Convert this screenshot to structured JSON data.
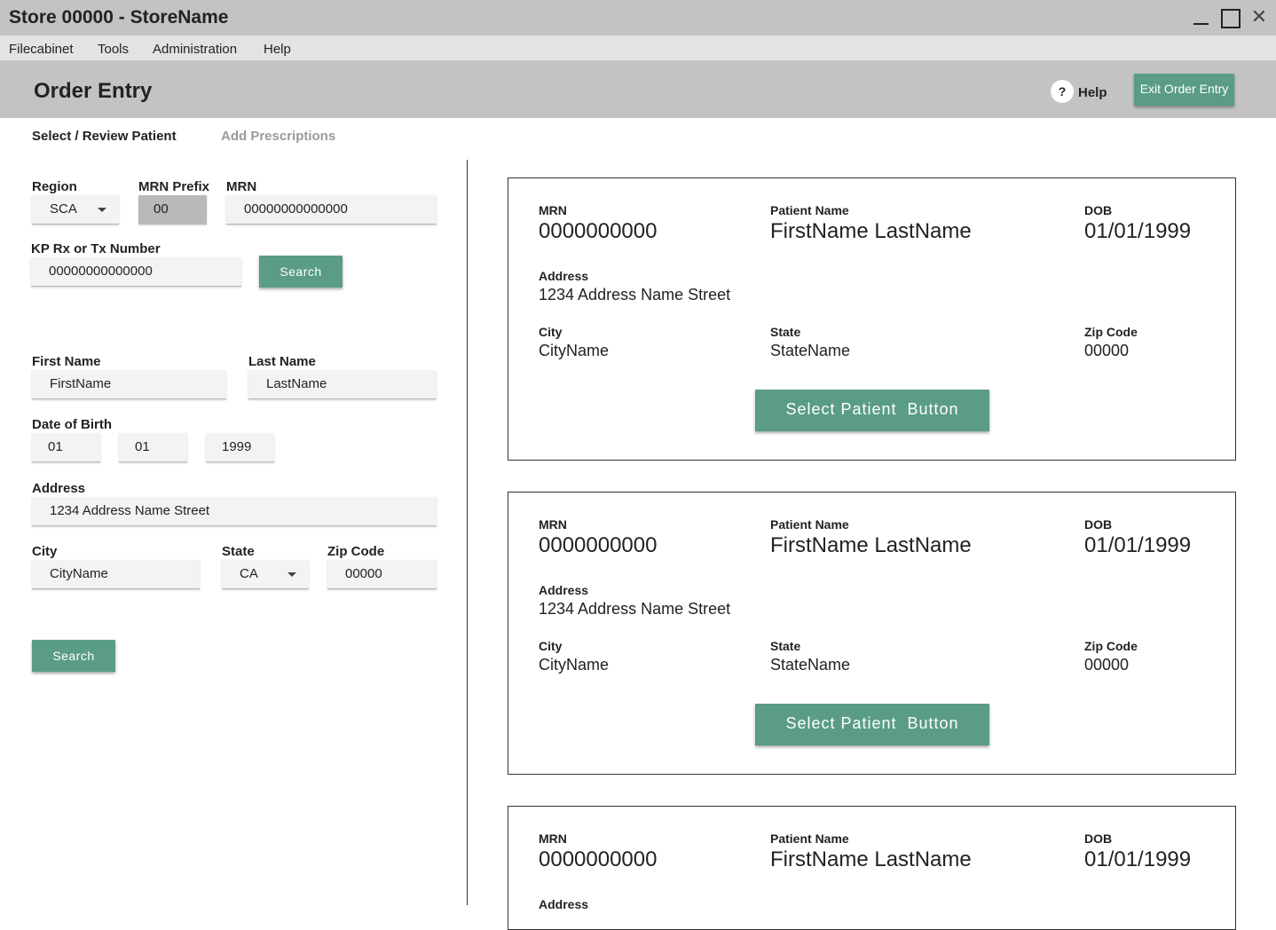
{
  "window": {
    "title": "Store 00000 - StoreName"
  },
  "menu": [
    "Filecabinet",
    "Tools",
    "Administration",
    "Help"
  ],
  "header": {
    "title": "Order Entry",
    "help_icon": "?",
    "help_label": "Help",
    "exit_label": "Exit Order Entry"
  },
  "steps": [
    "Select / Review Patient",
    "Add Prescriptions"
  ],
  "form": {
    "region_label": "Region",
    "region_value": "SCA",
    "mrn_prefix_label": "MRN Prefix",
    "mrn_prefix_value": "00",
    "mrn_label": "MRN",
    "mrn_value": "00000000000000",
    "rx_label": "KP Rx or Tx Number",
    "rx_value": "00000000000000",
    "search_label": "Search",
    "first_name_label": "First Name",
    "first_name_value": "FirstName",
    "last_name_label": "Last Name",
    "last_name_value": "LastName",
    "dob_label": "Date of Birth",
    "dob_month": "01",
    "dob_day": "01",
    "dob_year": "1999",
    "address_label": "Address",
    "address_value": "1234 Address Name Street",
    "city_label": "City",
    "city_value": "CityName",
    "state_label": "State",
    "state_value": "CA",
    "zip_label": "Zip Code",
    "zip_value": "00000",
    "search2_label": "Search"
  },
  "cards": [
    {
      "mrn_label": "MRN",
      "mrn": "0000000000",
      "name_label": "Patient Name",
      "name": "FirstName LastName",
      "dob_label": "DOB",
      "dob": "01/01/1999",
      "address_label": "Address",
      "address": "1234 Address Name Street",
      "city_label": "City",
      "city": "CityName",
      "state_label": "State",
      "state": "StateName",
      "zip_label": "Zip Code",
      "zip": "00000",
      "button": "Select Patient  Button"
    },
    {
      "mrn_label": "MRN",
      "mrn": "0000000000",
      "name_label": "Patient Name",
      "name": "FirstName LastName",
      "dob_label": "DOB",
      "dob": "01/01/1999",
      "address_label": "Address",
      "address": "1234 Address Name Street",
      "city_label": "City",
      "city": "CityName",
      "state_label": "State",
      "state": "StateName",
      "zip_label": "Zip Code",
      "zip": "00000",
      "button": "Select Patient  Button"
    },
    {
      "mrn_label": "MRN",
      "mrn": "0000000000",
      "name_label": "Patient Name",
      "name": "FirstName LastName",
      "dob_label": "DOB",
      "dob": "01/01/1999",
      "address_label": "Address"
    }
  ],
  "colors": {
    "accent": "#5a9c88",
    "titlebar": "#c3c3c3",
    "menubar": "#e3e3e3"
  }
}
